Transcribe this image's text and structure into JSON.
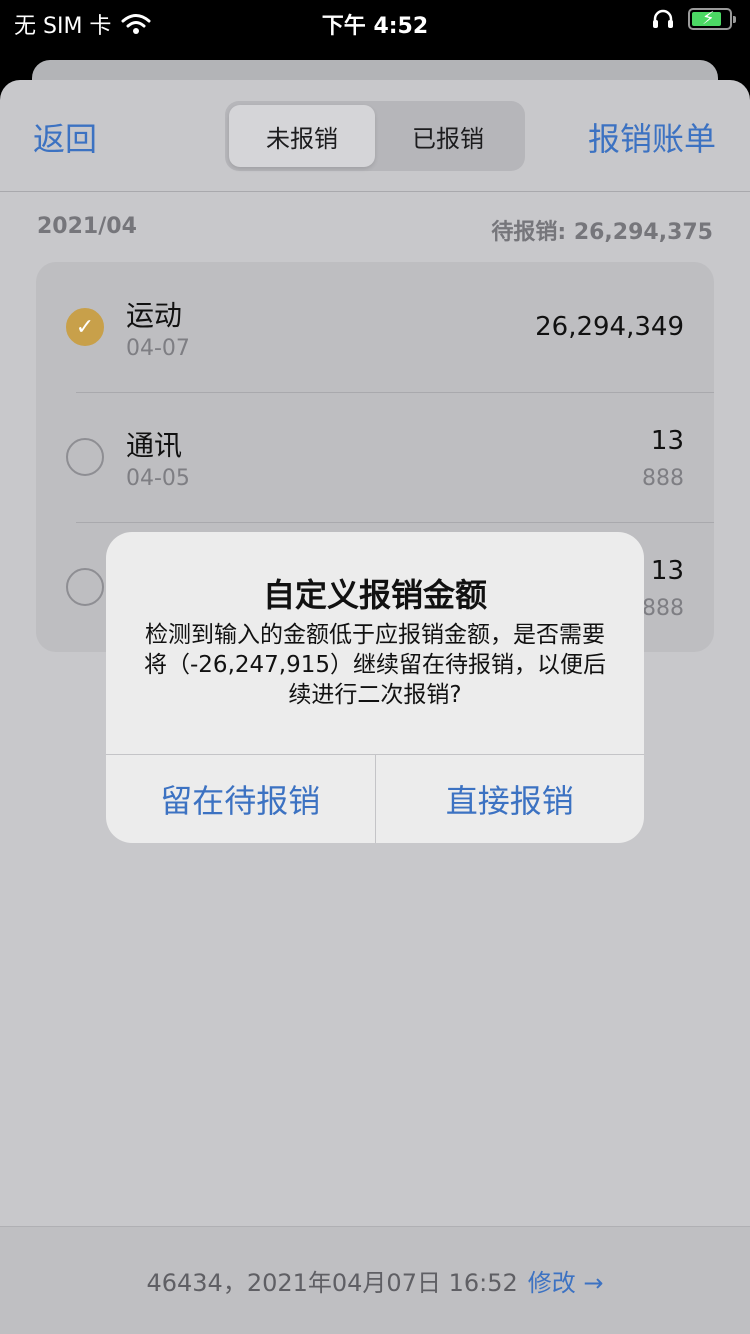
{
  "status_bar": {
    "carrier": "无 SIM 卡",
    "time": "下午 4:52",
    "battery_level": 0.8,
    "icons": [
      "wifi-icon",
      "headphones-icon",
      "battery-charging-icon"
    ]
  },
  "nav": {
    "back_label": "返回",
    "right_label": "报销账单",
    "tabs": [
      {
        "label": "未报销",
        "selected": true
      },
      {
        "label": "已报销",
        "selected": false
      }
    ]
  },
  "section": {
    "month": "2021/04",
    "pending": "待报销: 26,294,375"
  },
  "items": [
    {
      "title": "运动",
      "date": "04-07",
      "amount": "26,294,349",
      "sub": "",
      "checked": true
    },
    {
      "title": "通讯",
      "date": "04-05",
      "amount": "13",
      "sub": "888",
      "checked": false
    },
    {
      "title": "",
      "date": "",
      "amount": "13",
      "sub": "888",
      "checked": false
    }
  ],
  "footer": {
    "text": "46434，2021年04月07日 16:52",
    "link": "修改 →"
  },
  "alert": {
    "title": "自定义报销金额",
    "message": "检测到输入的金额低于应报销金额，是否需要将（-26,247,915）继续留在待报销，以便后续进行二次报销?",
    "left_button": "留在待报销",
    "right_button": "直接报销"
  },
  "colors": {
    "accent": "#3c72c2",
    "check": "#c8a04a"
  }
}
